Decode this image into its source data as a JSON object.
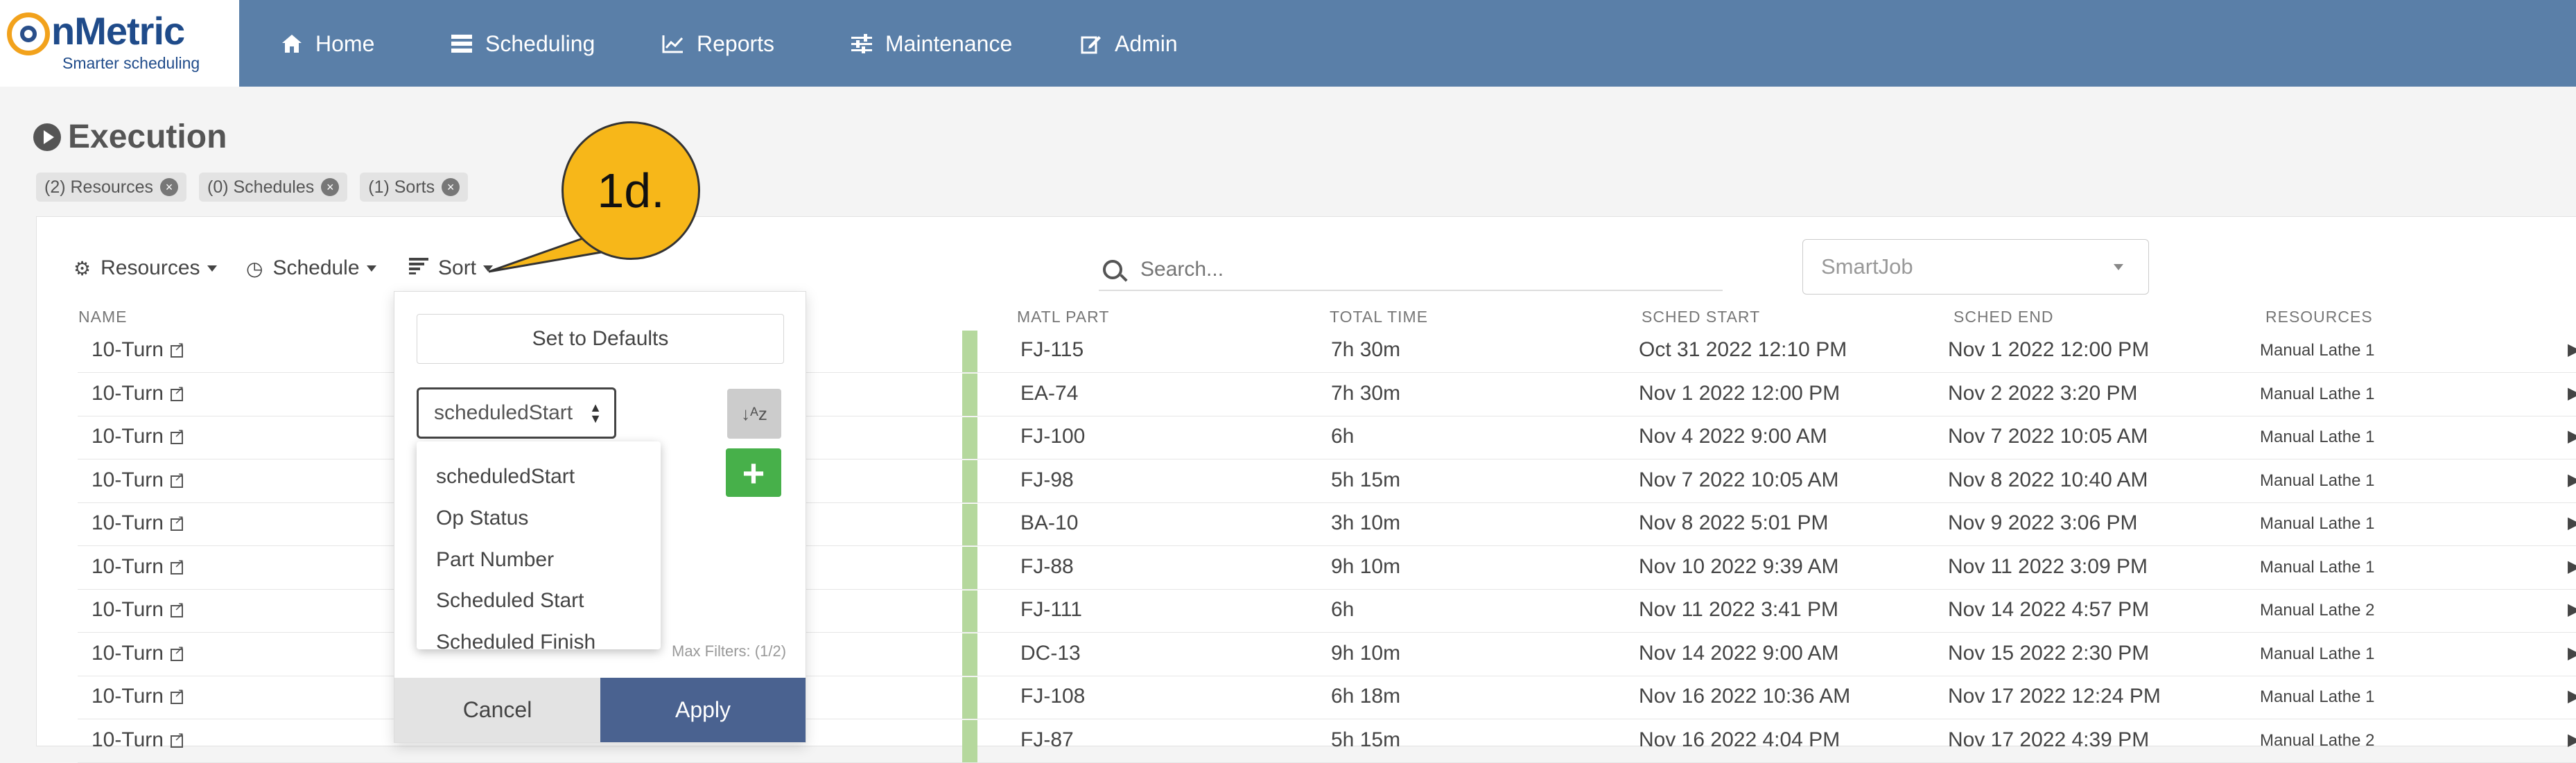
{
  "brand": {
    "name": "nMetric",
    "tagline": "Smarter scheduling"
  },
  "nav": [
    {
      "label": "Home",
      "icon": "home-icon"
    },
    {
      "label": "Scheduling",
      "icon": "list-icon"
    },
    {
      "label": "Reports",
      "icon": "chart-icon"
    },
    {
      "label": "Maintenance",
      "icon": "sliders-icon"
    },
    {
      "label": "Admin",
      "icon": "edit-icon"
    }
  ],
  "page": {
    "title": "Execution"
  },
  "chips": [
    "(2) Resources",
    "(0) Schedules",
    "(1) Sorts"
  ],
  "toolbar": {
    "resources": "Resources",
    "schedule": "Schedule",
    "sort": "Sort"
  },
  "search": {
    "placeholder": "Search..."
  },
  "view_select": {
    "value": "SmartJob"
  },
  "columns": [
    "NAME",
    "MATL PART",
    "TOTAL TIME",
    "SCHED START",
    "SCHED END",
    "RESOURCES"
  ],
  "rows": [
    {
      "name": "10-Turn",
      "part": "FJ-115",
      "total": "7h 30m",
      "start": "Oct 31 2022 12:10 PM",
      "end": "Nov 1 2022 12:00 PM",
      "resource": "Manual Lathe 1"
    },
    {
      "name": "10-Turn",
      "part": "EA-74",
      "total": "7h 30m",
      "start": "Nov 1 2022 12:00 PM",
      "end": "Nov 2 2022 3:20 PM",
      "resource": "Manual Lathe 1"
    },
    {
      "name": "10-Turn",
      "part": "FJ-100",
      "total": "6h",
      "start": "Nov 4 2022 9:00 AM",
      "end": "Nov 7 2022 10:05 AM",
      "resource": "Manual Lathe 1"
    },
    {
      "name": "10-Turn",
      "part": "FJ-98",
      "total": "5h 15m",
      "start": "Nov 7 2022 10:05 AM",
      "end": "Nov 8 2022 10:40 AM",
      "resource": "Manual Lathe 1"
    },
    {
      "name": "10-Turn",
      "part": "BA-10",
      "total": "3h 10m",
      "start": "Nov 8 2022 5:01 PM",
      "end": "Nov 9 2022 3:06 PM",
      "resource": "Manual Lathe 1"
    },
    {
      "name": "10-Turn",
      "part": "FJ-88",
      "total": "9h 10m",
      "start": "Nov 10 2022 9:39 AM",
      "end": "Nov 11 2022 3:09 PM",
      "resource": "Manual Lathe 1"
    },
    {
      "name": "10-Turn",
      "part": "FJ-111",
      "total": "6h",
      "start": "Nov 11 2022 3:41 PM",
      "end": "Nov 14 2022 4:57 PM",
      "resource": "Manual Lathe 2"
    },
    {
      "name": "10-Turn",
      "part": "DC-13",
      "total": "9h 10m",
      "start": "Nov 14 2022 9:00 AM",
      "end": "Nov 15 2022 2:30 PM",
      "resource": "Manual Lathe 1"
    },
    {
      "name": "10-Turn",
      "part": "FJ-108",
      "total": "6h 18m",
      "start": "Nov 16 2022 10:36 AM",
      "end": "Nov 17 2022 12:24 PM",
      "resource": "Manual Lathe 1"
    },
    {
      "name": "10-Turn",
      "part": "FJ-87",
      "total": "5h 15m",
      "start": "Nov 16 2022 4:04 PM",
      "end": "Nov 17 2022 4:39 PM",
      "resource": "Manual Lathe 2"
    }
  ],
  "sort_panel": {
    "defaults_label": "Set to Defaults",
    "selected": "scheduledStart",
    "options": [
      "scheduledStart",
      "Op Status",
      "Part Number",
      "Scheduled Start",
      "Scheduled Finish"
    ],
    "max_filters": "Max Filters: (1/2)",
    "cancel_label": "Cancel",
    "apply_label": "Apply"
  },
  "callout": {
    "label": "1d."
  },
  "colors": {
    "nav": "#5a7fa8",
    "apply": "#4a6290",
    "add": "#47b04a",
    "callout": "#f7b719"
  }
}
